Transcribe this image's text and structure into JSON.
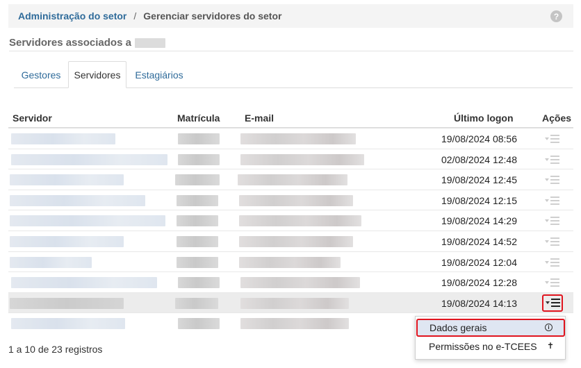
{
  "breadcrumb": {
    "link": "Administração do setor",
    "separator": "/",
    "current": "Gerenciar servidores do setor",
    "help_icon": "question-circle-icon",
    "help_glyph": "?"
  },
  "section": {
    "title": "Servidores associados a"
  },
  "tabs": [
    {
      "label": "Gestores",
      "active": false
    },
    {
      "label": "Servidores",
      "active": true
    },
    {
      "label": "Estagiários",
      "active": false
    }
  ],
  "table": {
    "headers": {
      "servidor": "Servidor",
      "matricula": "Matrícula",
      "email": "E-mail",
      "ultimo_logon": "Último logon",
      "acoes": "Ações"
    },
    "rows": [
      {
        "ultimo_logon": "19/08/2024 08:56"
      },
      {
        "ultimo_logon": "02/08/2024 12:48"
      },
      {
        "ultimo_logon": "19/08/2024 12:45"
      },
      {
        "ultimo_logon": "19/08/2024 12:15"
      },
      {
        "ultimo_logon": "19/08/2024 14:29"
      },
      {
        "ultimo_logon": "19/08/2024 14:52"
      },
      {
        "ultimo_logon": "19/08/2024 12:04"
      },
      {
        "ultimo_logon": "19/08/2024 12:28"
      },
      {
        "ultimo_logon": "19/08/2024 14:13"
      },
      {
        "ultimo_logon": ""
      }
    ]
  },
  "dropdown": {
    "items": [
      {
        "label": "Dados gerais",
        "icon": "info-icon"
      },
      {
        "label": "Permissões no e-TCEES",
        "icon": "accessibility-icon"
      }
    ],
    "info_glyph": "i",
    "person_glyph": "✝"
  },
  "footer": {
    "records": "1 a 10 de 23 registros"
  },
  "colors": {
    "link": "#2f6b9a",
    "highlight_border": "#e0141e",
    "menu_hover": "#dfe6f2"
  }
}
